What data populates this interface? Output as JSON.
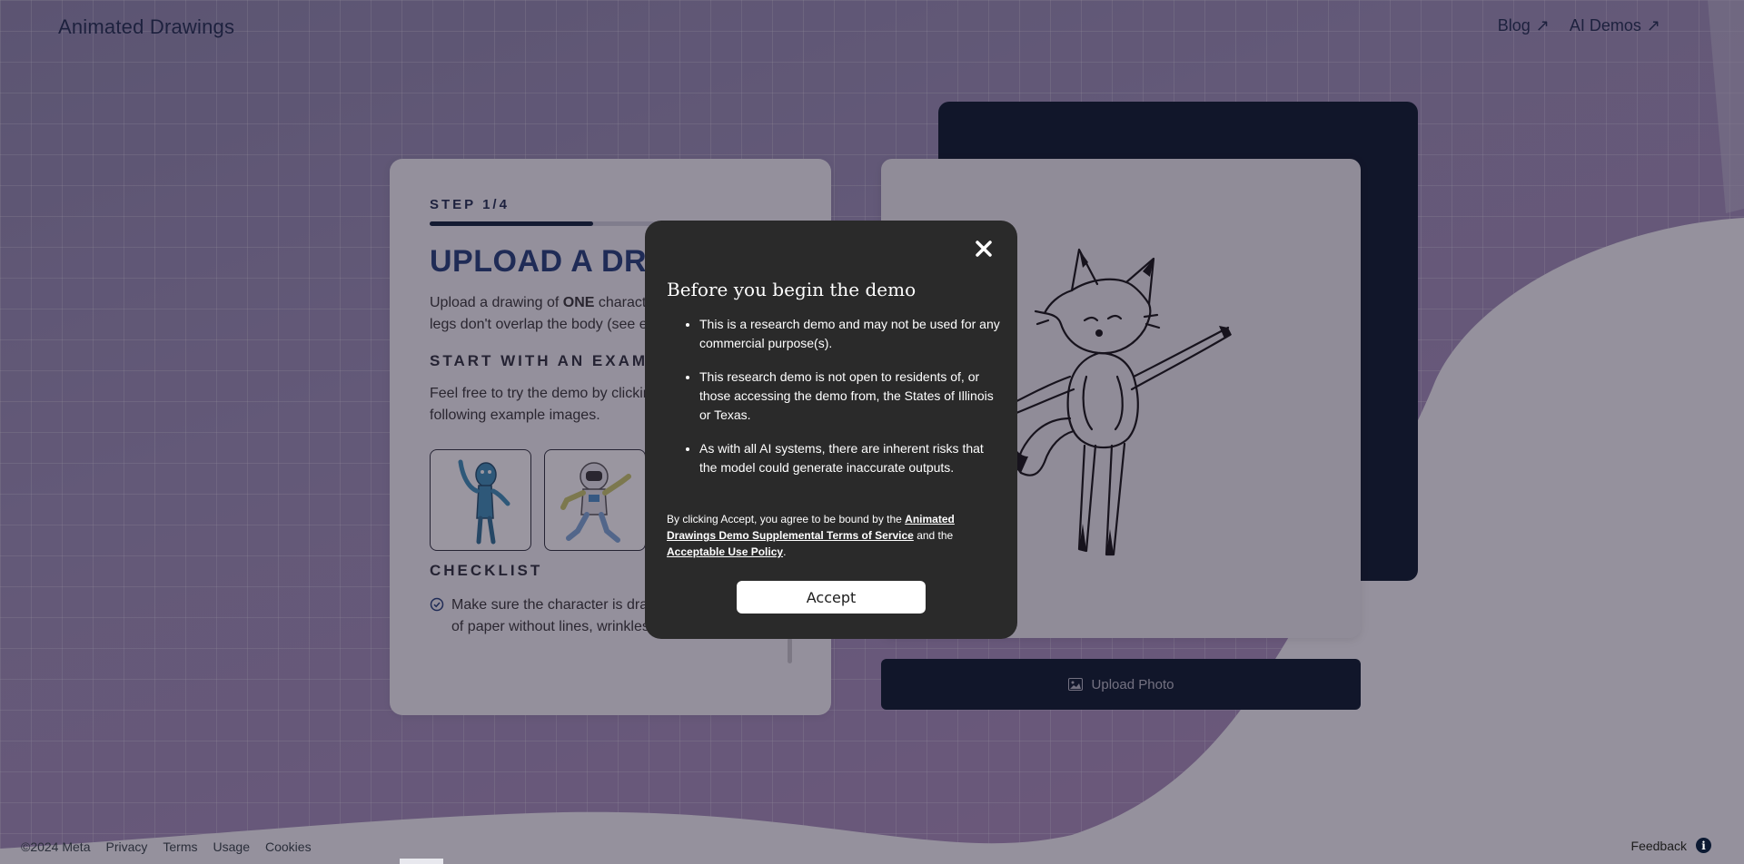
{
  "header": {
    "brand": "Animated Drawings",
    "nav": [
      {
        "label": "Blog"
      },
      {
        "label": "AI Demos"
      }
    ]
  },
  "left_card": {
    "step": "STEP 1/4",
    "progress_fraction": 0.45,
    "title": "UPLOAD A DRAWING",
    "description_prefix": "Upload a drawing of ",
    "description_bold": "ONE",
    "description_suffix": " character, where the arms and legs don't overlap the body (see examples).",
    "examples_heading": "START WITH AN EXAMPLE",
    "examples_description": "Feel free to try the demo by clicking on one of the following example images.",
    "checklist_heading": "CHECKLIST",
    "checklist": [
      "Make sure the character is drawn on a white piece of paper without lines, wrinkles, or tears."
    ]
  },
  "preview": {
    "upload_label": "Upload Photo"
  },
  "modal": {
    "title": "Before you begin the demo",
    "items": [
      "This is a research demo and may not be used for any commercial purpose(s).",
      "This research demo is not open to residents of, or those accessing the demo from, the States of Illinois or Texas.",
      "As with all AI systems, there are inherent risks that the model could generate inaccurate outputs."
    ],
    "terms_prefix": "By clicking Accept, you agree to be bound by the ",
    "terms_link1": "Animated Drawings Demo Supplemental Terms of Service",
    "terms_middle": " and the ",
    "terms_link2": "Acceptable Use Policy",
    "terms_suffix": ".",
    "accept_label": "Accept"
  },
  "footer": {
    "copyright": "©2024 Meta",
    "links": [
      "Privacy",
      "Terms",
      "Usage",
      "Cookies"
    ],
    "feedback": "Feedback"
  },
  "colors": {
    "accent_dark": "#071628",
    "title_blue": "#1f3d78",
    "modal_bg": "#2a2a2a"
  },
  "icons": {
    "nav_arrow": "external-arrow-icon",
    "close": "close-icon",
    "upload": "image-icon",
    "check": "check-circle-icon",
    "info": "info-icon"
  }
}
